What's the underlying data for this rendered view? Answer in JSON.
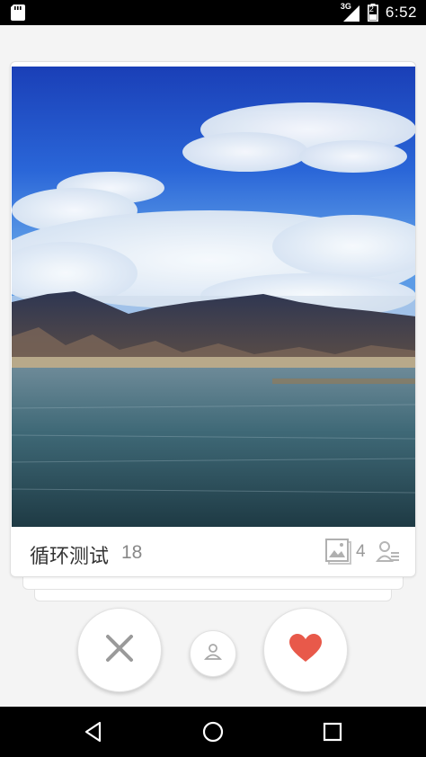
{
  "status_bar": {
    "time": "6:52",
    "network_type": "3G",
    "battery_level": "2",
    "icons": [
      "sd-card-icon",
      "signal-3g-icon",
      "battery-icon"
    ]
  },
  "card": {
    "title": "循环测试",
    "age": "18",
    "photo_count": "4",
    "image_description_icon": "landscape-photo",
    "icons": [
      "photo-gallery-icon",
      "profile-list-icon"
    ]
  },
  "actions": {
    "icons": [
      "close-icon",
      "person-icon",
      "heart-icon"
    ]
  },
  "colors": {
    "like_red": "#e8594a",
    "dislike_gray": "#9a9a9a",
    "status_bar_bg": "#000000",
    "nav_bar_bg": "#000000"
  },
  "nav_bar": {
    "icons": [
      "back-icon",
      "home-icon",
      "recents-icon"
    ]
  }
}
